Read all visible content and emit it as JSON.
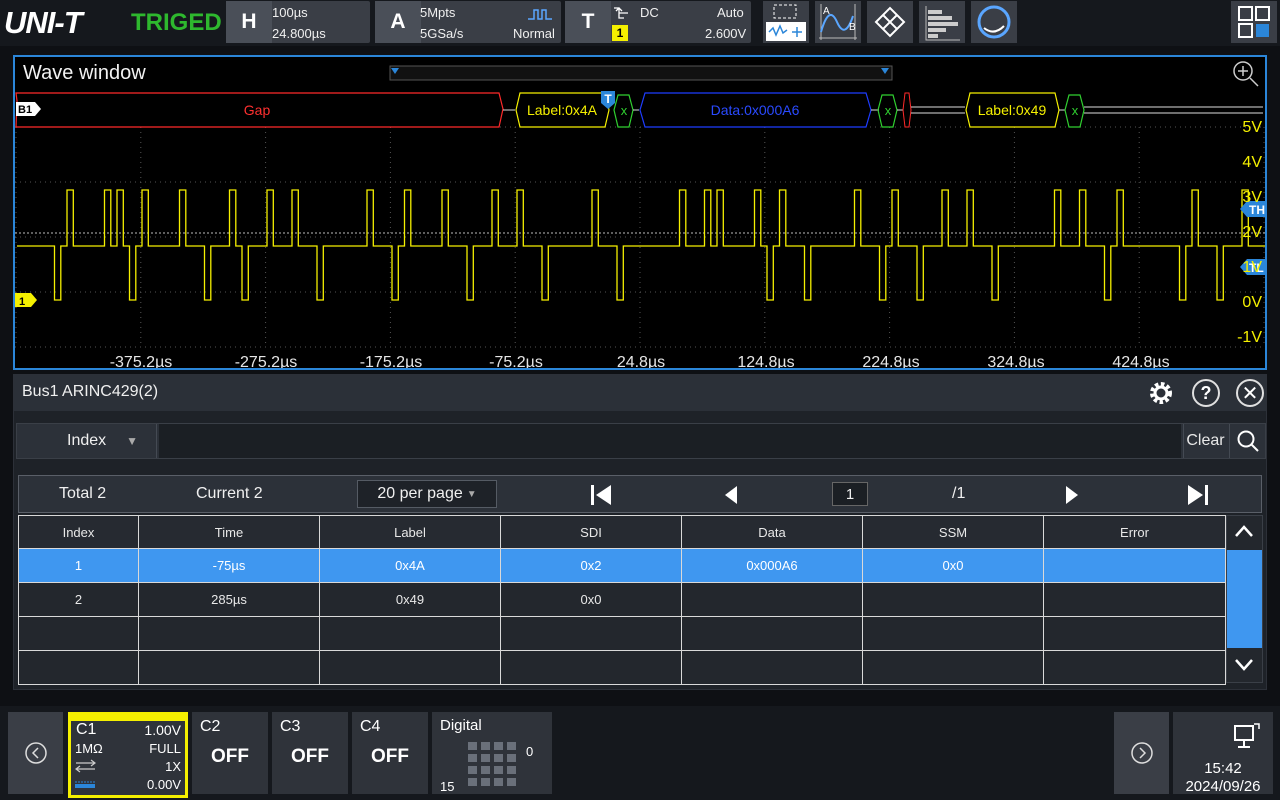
{
  "topbar": {
    "logo": "UNI-T",
    "trigger_status": "TRIGED",
    "horizontal": {
      "letter": "H",
      "timebase": "100µs",
      "position": "24.800µs"
    },
    "acquire": {
      "letter": "A",
      "depth": "5Mpts",
      "rate": "5GSa/s",
      "mode": "Normal"
    },
    "trigger": {
      "letter": "T",
      "coupling": "DC",
      "sweep": "Auto",
      "source": "1",
      "level": "2.600V"
    },
    "colors": {
      "accent": "#2b86d9",
      "channel1": "#f5f000",
      "triged": "#2eb82e"
    }
  },
  "wave": {
    "title": "Wave window",
    "bus_label": "B1",
    "channel_marker": "1",
    "trigger_marker": "T",
    "threshold_high": "TH",
    "threshold_low": "TL",
    "decode": {
      "gap": "Gap",
      "label1": "Label:0x4A",
      "x1": "x",
      "data1": "Data:0x000A6",
      "x2": "x",
      "label2": "Label:0x49",
      "x3": "x"
    },
    "volt_labels": [
      "5V",
      "4V",
      "3V",
      "2V",
      "1V",
      "0V",
      "-1V"
    ],
    "time_labels": [
      "-375.2µs",
      "-275.2µs",
      "-175.2µs",
      "-75.2µs",
      "24.8µs",
      "124.8µs",
      "224.8µs",
      "324.8µs",
      "424.8µs"
    ]
  },
  "panel": {
    "title": "Bus1 ARINC429(2)",
    "search_field": "Index",
    "search_placeholder": "",
    "clear": "Clear",
    "total": "Total 2",
    "current": "Current 2",
    "per_page": "20 per page",
    "page": "1",
    "page_total": "/1",
    "columns": [
      "Index",
      "Time",
      "Label",
      "SDI",
      "Data",
      "SSM",
      "Error"
    ],
    "rows": [
      [
        "1",
        "-75µs",
        "0x4A",
        "0x2",
        "0x000A6",
        "0x0",
        ""
      ],
      [
        "2",
        "285µs",
        "0x49",
        "0x0",
        "",
        "",
        ""
      ],
      [
        "",
        "",
        "",
        "",
        "",
        "",
        ""
      ],
      [
        "",
        "",
        "",
        "",
        "",
        "",
        ""
      ]
    ]
  },
  "bottombar": {
    "c1": {
      "name": "C1",
      "scale": "1.00V",
      "impedance": "1MΩ",
      "bandwidth": "FULL",
      "probe": "1X",
      "offset": "0.00V"
    },
    "c2": {
      "name": "C2",
      "state": "OFF"
    },
    "c3": {
      "name": "C3",
      "state": "OFF"
    },
    "c4": {
      "name": "C4",
      "state": "OFF"
    },
    "digital": {
      "name": "Digital",
      "low": "0",
      "high": "15"
    },
    "time": "15:42",
    "date": "2024/09/26"
  }
}
